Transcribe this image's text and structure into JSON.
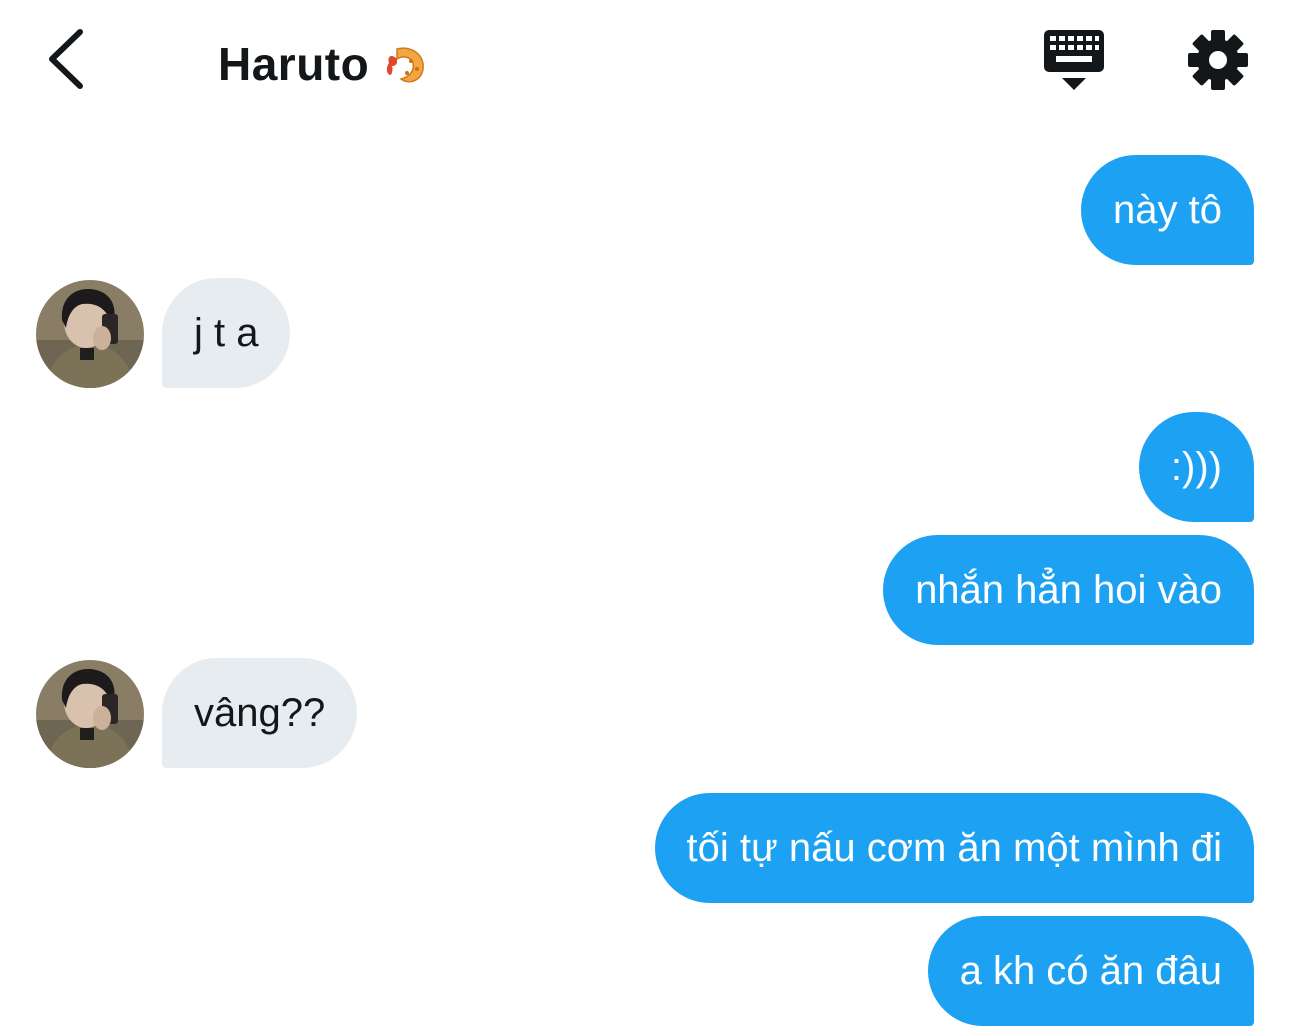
{
  "header": {
    "title": "Haruto",
    "title_emoji": "fried-shrimp-emoji",
    "back_icon": "chevron-left-icon",
    "keyboard_icon": "keyboard-hide-icon",
    "settings_icon": "gear-icon"
  },
  "colors": {
    "outgoing_bubble": "#1da1f2",
    "incoming_bubble": "#e6ecf0",
    "text_dark": "#14171a"
  },
  "messages": [
    {
      "side": "out",
      "text": "này tô"
    },
    {
      "side": "in",
      "text": "j t a"
    },
    {
      "side": "out",
      "text": ":)))"
    },
    {
      "side": "out",
      "text": "nhắn hẳn hoi vào"
    },
    {
      "side": "in",
      "text": "vâng??"
    },
    {
      "side": "out",
      "text": "tối tự nấu cơm ăn một mình đi"
    },
    {
      "side": "out",
      "text": "a kh có ăn đâu"
    }
  ]
}
